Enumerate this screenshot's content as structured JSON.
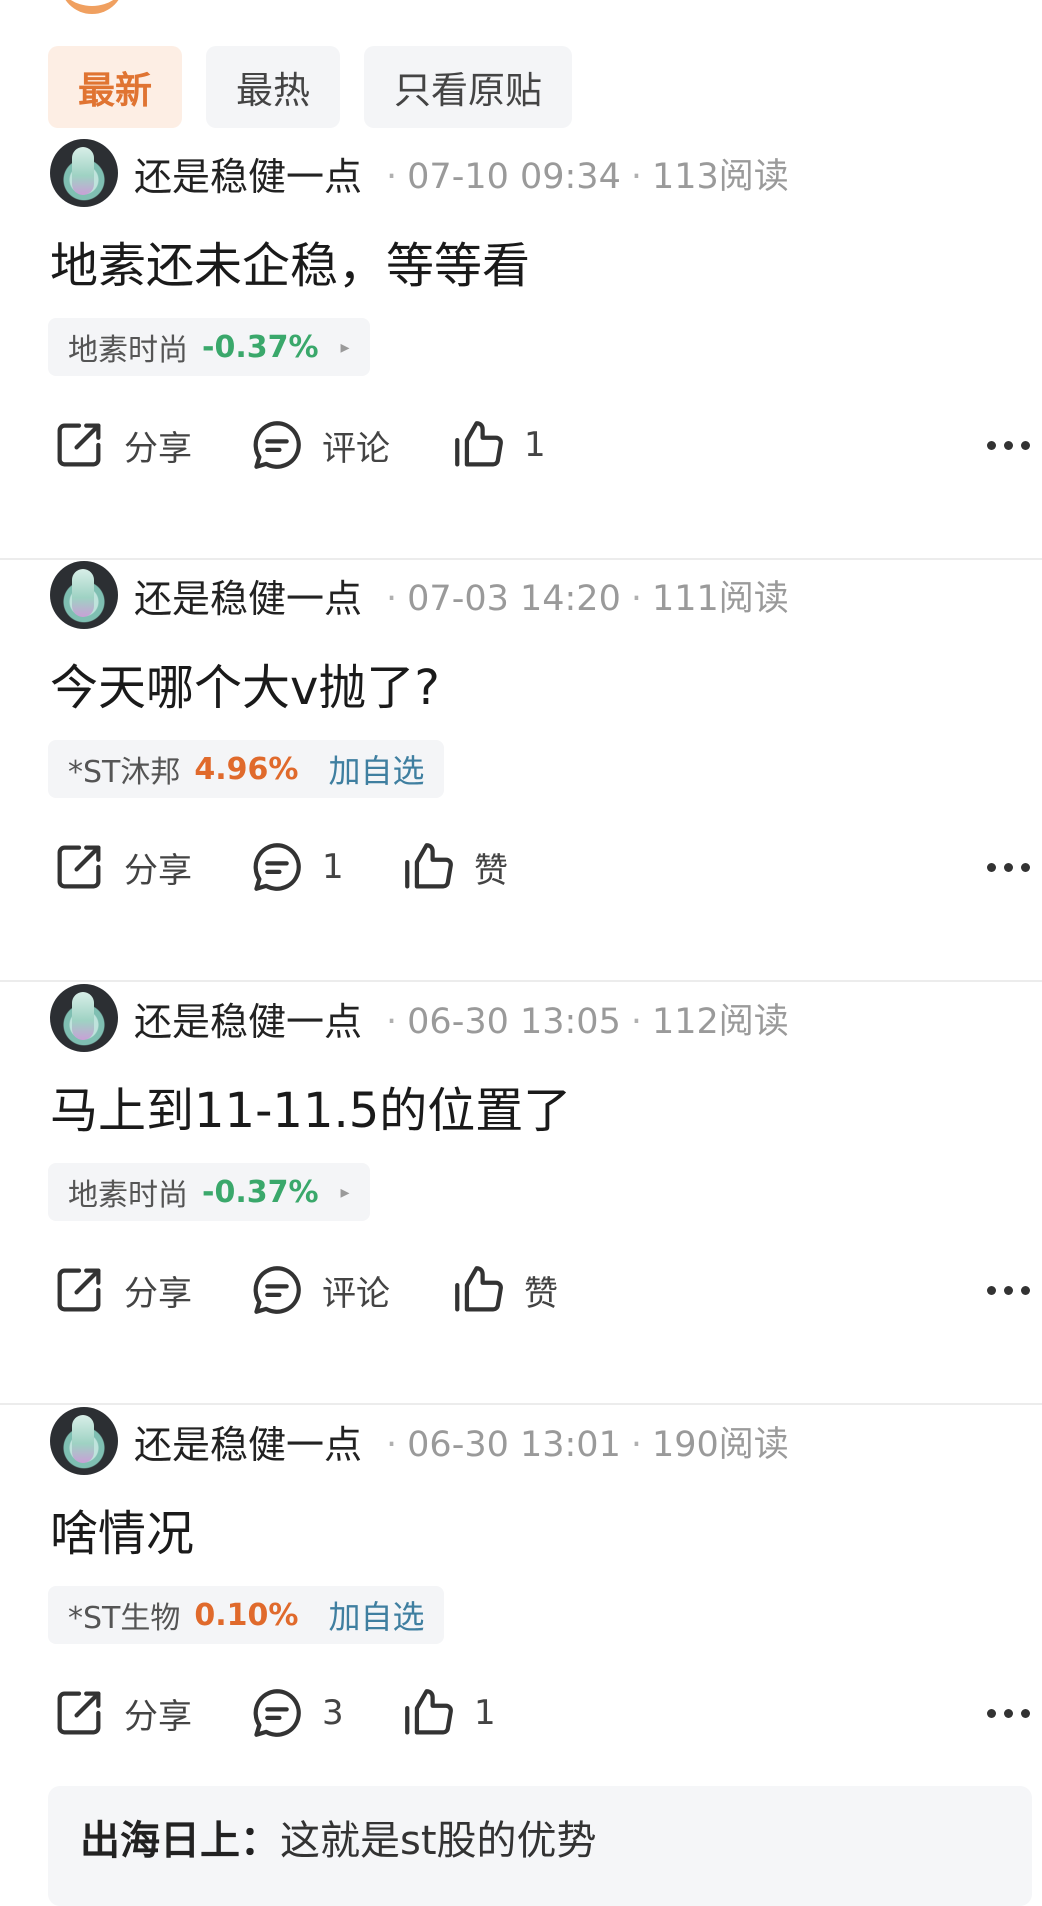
{
  "tabs": [
    {
      "label": "最新",
      "active": true
    },
    {
      "label": "最热",
      "active": false
    },
    {
      "label": "只看原贴",
      "active": false
    }
  ],
  "posts": [
    {
      "author": "还是稳健一点",
      "time": "07-10 09:34",
      "reads": "113阅读",
      "content": "地素还未企稳，等等看",
      "stock": {
        "name": "地素时尚",
        "change": "-0.37%",
        "direction": "down",
        "extra": "▸"
      },
      "share": "分享",
      "comment": "评论",
      "like": "1"
    },
    {
      "author": "还是稳健一点",
      "time": "07-03 14:20",
      "reads": "111阅读",
      "content": "今天哪个大v抛了?",
      "stock": {
        "name": "*ST沐邦",
        "change": "4.96%",
        "direction": "up",
        "extra": "加自选"
      },
      "share": "分享",
      "comment": "1",
      "like": "赞"
    },
    {
      "author": "还是稳健一点",
      "time": "06-30 13:05",
      "reads": "112阅读",
      "content": "马上到11-11.5的位置了",
      "stock": {
        "name": "地素时尚",
        "change": "-0.37%",
        "direction": "down",
        "extra": "▸"
      },
      "share": "分享",
      "comment": "评论",
      "like": "赞"
    },
    {
      "author": "还是稳健一点",
      "time": "06-30 13:01",
      "reads": "190阅读",
      "content": "啥情况",
      "stock": {
        "name": "*ST生物",
        "change": "0.10%",
        "direction": "up",
        "extra": "加自选"
      },
      "share": "分享",
      "comment": "3",
      "like": "1"
    }
  ],
  "reply": {
    "user": "出海日上：",
    "text": "这就是st股的优势"
  },
  "colors": {
    "accent": "#e07432",
    "down": "#3aa86b",
    "up": "#e06a2c",
    "link": "#3f7fa0"
  }
}
